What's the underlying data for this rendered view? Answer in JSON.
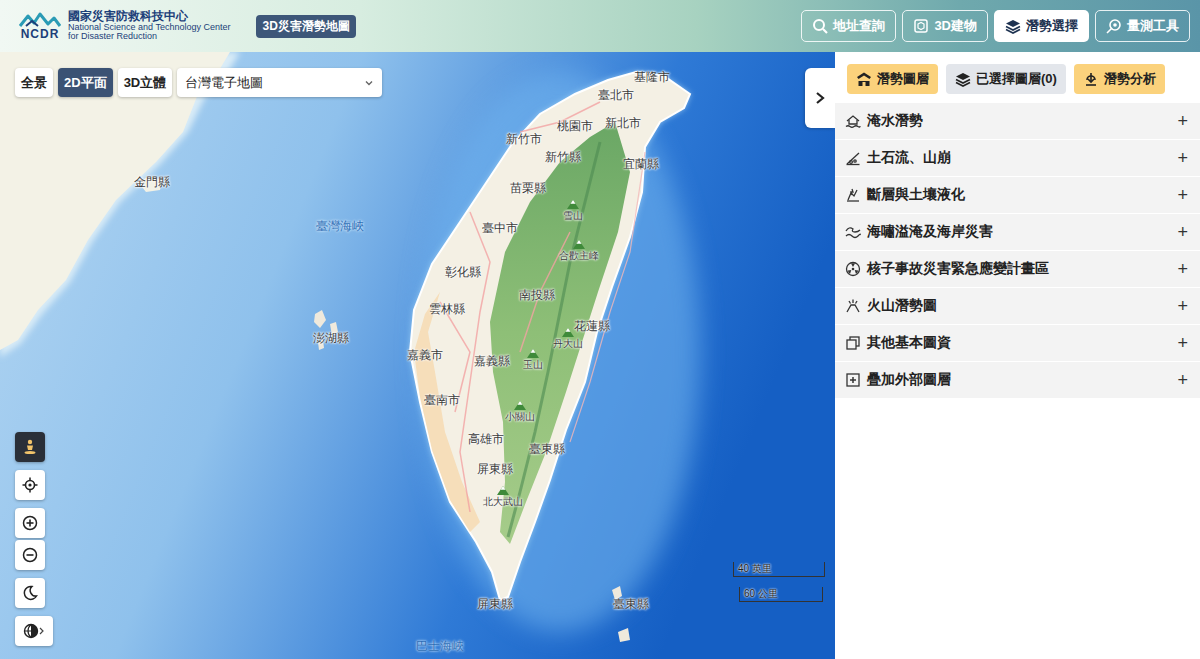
{
  "header": {
    "logo_mark": "NCDR",
    "org_name": "國家災害防救科技中心",
    "org_en_1": "National Science and Technology Center",
    "org_en_2": "for Disaster Reduction",
    "app_badge": "3D災害潛勢地圖",
    "nav": [
      {
        "label": "地址查詢",
        "selected": false
      },
      {
        "label": "3D建物",
        "selected": false
      },
      {
        "label": "潛勢選擇",
        "selected": true
      },
      {
        "label": "量測工具",
        "selected": false
      }
    ]
  },
  "map": {
    "view_modes": [
      {
        "label": "全景",
        "selected": false
      },
      {
        "label": "2D平面",
        "selected": true
      },
      {
        "label": "3D立體",
        "selected": false
      }
    ],
    "basemap": "台灣電子地圖",
    "tools": [
      {
        "selected": true
      },
      {
        "selected": false
      },
      {
        "selected": false
      },
      {
        "selected": false
      },
      {
        "selected": false
      },
      {
        "selected": false
      }
    ],
    "scale": [
      "40 英里",
      "60 公里"
    ],
    "labels": [
      {
        "text": "基隆市",
        "kind": "city"
      },
      {
        "text": "臺北市",
        "kind": "city"
      },
      {
        "text": "新北市",
        "kind": "city"
      },
      {
        "text": "桃園市",
        "kind": "city"
      },
      {
        "text": "新竹市",
        "kind": "city"
      },
      {
        "text": "新竹縣",
        "kind": "city"
      },
      {
        "text": "宜蘭縣",
        "kind": "city"
      },
      {
        "text": "金門縣",
        "kind": "city"
      },
      {
        "text": "苗栗縣",
        "kind": "city"
      },
      {
        "text": "雪山",
        "kind": "peak"
      },
      {
        "text": "臺灣海峽",
        "kind": "sea"
      },
      {
        "text": "臺中市",
        "kind": "city"
      },
      {
        "text": "合歡主峰",
        "kind": "peak"
      },
      {
        "text": "彰化縣",
        "kind": "city"
      },
      {
        "text": "南投縣",
        "kind": "city"
      },
      {
        "text": "雲林縣",
        "kind": "city"
      },
      {
        "text": "花蓮縣",
        "kind": "city"
      },
      {
        "text": "丹大山",
        "kind": "peak"
      },
      {
        "text": "澎湖縣",
        "kind": "city"
      },
      {
        "text": "嘉義市",
        "kind": "city"
      },
      {
        "text": "嘉義縣",
        "kind": "city"
      },
      {
        "text": "玉山",
        "kind": "peak"
      },
      {
        "text": "臺南市",
        "kind": "city"
      },
      {
        "text": "小關山",
        "kind": "peak"
      },
      {
        "text": "高雄市",
        "kind": "city"
      },
      {
        "text": "臺東縣",
        "kind": "city"
      },
      {
        "text": "屏東縣",
        "kind": "city"
      },
      {
        "text": "北大武山",
        "kind": "peak"
      },
      {
        "text": "屏東縣",
        "kind": "city"
      },
      {
        "text": "臺東縣",
        "kind": "city"
      },
      {
        "text": "巴士海峽",
        "kind": "sea"
      }
    ]
  },
  "panel": {
    "buttons": [
      {
        "label": "潛勢圖層",
        "kind": "accent"
      },
      {
        "label": "已選擇圖層(0)",
        "kind": "plain"
      },
      {
        "label": "潛勢分析",
        "kind": "accent"
      }
    ],
    "categories": [
      {
        "label": "淹水潛勢",
        "toggle": "+",
        "expanded": false
      },
      {
        "label": "土石流、山崩",
        "toggle": "+",
        "expanded": false
      },
      {
        "label": "斷層與土壤液化",
        "toggle": "+",
        "expanded": false
      },
      {
        "label": "海嘯溢淹及海岸災害",
        "toggle": "+",
        "expanded": false
      },
      {
        "label": "核子事故災害緊急應變計畫區",
        "toggle": "+",
        "expanded": false
      },
      {
        "label": "火山潛勢圖",
        "toggle": "+",
        "expanded": false
      },
      {
        "label": "其他基本圖資",
        "toggle": "+",
        "expanded": false
      },
      {
        "label": "疊加外部圖層",
        "toggle": "+",
        "expanded": false
      }
    ]
  }
}
